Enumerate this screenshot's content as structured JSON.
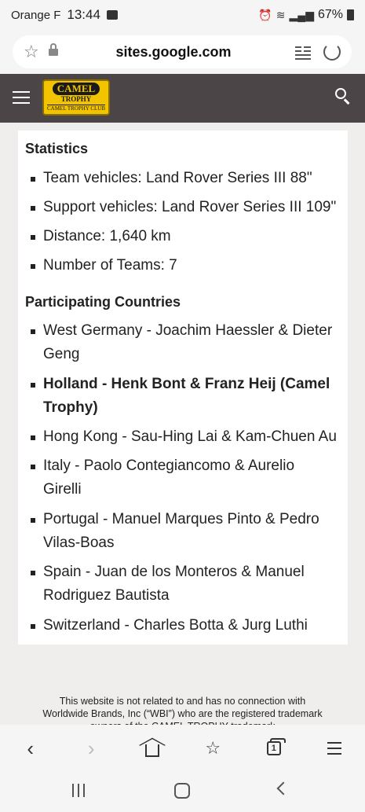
{
  "status": {
    "carrier": "Orange F",
    "time": "13:44",
    "battery": "67%"
  },
  "browser": {
    "url": "sites.google.com"
  },
  "site": {
    "logo_top": "CAMEL",
    "logo_mid": "TROPHY",
    "logo_bottom": "CAMEL TROPHY CLUB"
  },
  "content": {
    "statistics_title": "Statistics",
    "statistics": [
      "Team vehicles: Land Rover Series III 88\"",
      "Support vehicles: Land Rover Series III 109\"",
      "Distance: 1,640 km",
      "Number of Teams: 7"
    ],
    "countries_title": "Participating Countries",
    "countries": [
      {
        "line1": "West Germany - Joachim Haessler & Dieter",
        "line2": "Geng"
      },
      {
        "line1": "Holland - Henk Bont & Franz Heij (Camel",
        "line2": "Trophy)"
      },
      {
        "line1": "Hong Kong - Sau-Hing Lai & Kam-Chuen Au"
      },
      {
        "line1": "Italy - Paolo Contegiancomo & Aurelio",
        "line2": "Girelli"
      },
      {
        "line1": "Portugal - Manuel Marques Pinto & Pedro",
        "line2": "Vilas-Boas"
      },
      {
        "line1": "Spain - Juan de los Monteros & Manuel",
        "line2": "Rodriguez Bautista"
      },
      {
        "line1": "Switzerland - Charles Botta & Jurg Luthi"
      }
    ]
  },
  "footer": {
    "line1": "This website is not related to and has no connection with",
    "line2": "Worldwide Brands, Inc (“WBI”)  who are the registered trademark",
    "line3": "owners of the CAMEL TROPHY trademark"
  },
  "icons": {
    "tab_count": "1"
  }
}
